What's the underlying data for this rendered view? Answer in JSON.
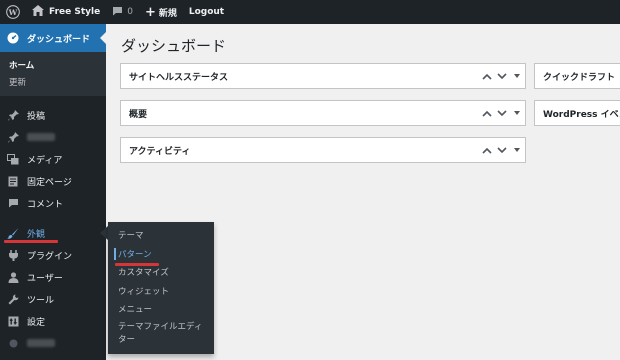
{
  "adminbar": {
    "site_name": "Free Style",
    "comments_count": "0",
    "new_label": "新規",
    "logout_label": "Logout"
  },
  "sidebar": {
    "dashboard_label": "ダッシュボード",
    "dashboard_sub": [
      "ホーム",
      "更新"
    ],
    "items": [
      {
        "label": "投稿",
        "icon": "pin-icon"
      },
      {
        "label": "",
        "icon": "pin-icon",
        "blurred": true
      },
      {
        "label": "メディア",
        "icon": "media-icon"
      },
      {
        "label": "固定ページ",
        "icon": "page-icon"
      },
      {
        "label": "コメント",
        "icon": "comment-icon"
      },
      {
        "label": "外観",
        "icon": "appearance-icon"
      },
      {
        "label": "プラグイン",
        "icon": "plugin-icon"
      },
      {
        "label": "ユーザー",
        "icon": "user-icon"
      },
      {
        "label": "ツール",
        "icon": "tool-icon"
      },
      {
        "label": "設定",
        "icon": "settings-icon"
      }
    ]
  },
  "flyout": {
    "items": [
      "テーマ",
      "パターン",
      "カスタマイズ",
      "ウィジェット",
      "メニュー",
      "テーマファイルエディター"
    ],
    "theme_editor_line1": "テーマファイルエディ",
    "theme_editor_line2": "ター"
  },
  "main": {
    "title": "ダッシュボード",
    "boxes": {
      "site_health": "サイトヘルスステータス",
      "overview": "概要",
      "activity": "アクティビティ",
      "quick_draft": "クイックドラフト",
      "wp_events": "WordPress イベン"
    }
  },
  "colors": {
    "admin_dark": "#1d2327",
    "accent_blue": "#2271b1",
    "hover_blue": "#72aee6",
    "annotation_red": "#d63638"
  }
}
